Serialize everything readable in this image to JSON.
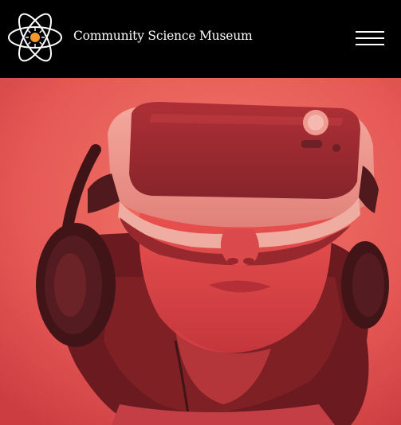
{
  "header": {
    "site_title": "Community Science Museum",
    "logo_icon": "atom-icon",
    "menu_icon": "hamburger-menu-icon"
  },
  "hero": {
    "image_subject": "person-wearing-vr-headset-and-headphones",
    "tint_color": "#e8574f"
  },
  "colors": {
    "header_background": "#000000",
    "logo_accent": "#f39a2a",
    "text": "#ffffff"
  }
}
